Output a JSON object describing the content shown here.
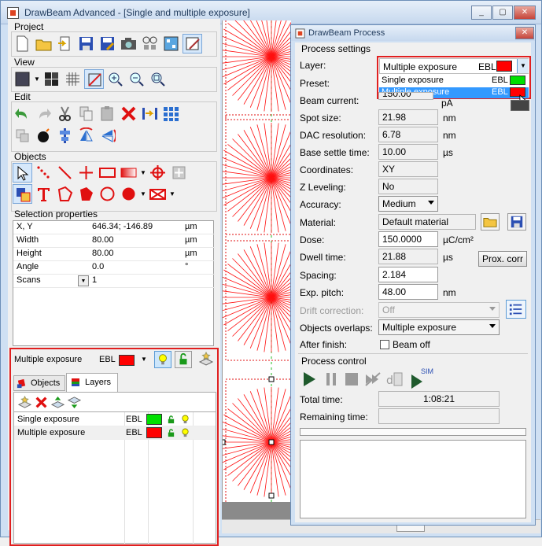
{
  "main_window": {
    "title": "DrawBeam Advanced - [Single and multiple exposure]",
    "controls": {
      "minimize": "_",
      "maximize": "▢",
      "close": "✕"
    }
  },
  "toolbar_groups": {
    "project": "Project",
    "view": "View",
    "edit": "Edit",
    "objects": "Objects"
  },
  "selection_properties": {
    "title": "Selection properties",
    "rows": [
      {
        "key": "X, Y",
        "value": "646.34; -146.89",
        "unit": "µm"
      },
      {
        "key": "Width",
        "value": "80.00",
        "unit": "µm"
      },
      {
        "key": "Height",
        "value": "80.00",
        "unit": "µm"
      },
      {
        "key": "Angle",
        "value": "0.0",
        "unit": "°"
      },
      {
        "key": "Scans",
        "value": "1",
        "unit": ""
      }
    ]
  },
  "layer_panel": {
    "current_layer": "Multiple exposure",
    "current_type": "EBL",
    "tabs": {
      "objects": "Objects",
      "layers": "Layers"
    },
    "layers": [
      {
        "name": "Single exposure",
        "type": "EBL",
        "color": "#00e000"
      },
      {
        "name": "Multiple exposure",
        "type": "EBL",
        "color": "#ff0000"
      }
    ]
  },
  "process_window": {
    "title": "DrawBeam Process",
    "close": "✕",
    "settings_title": "Process settings",
    "layer": {
      "label": "Layer:",
      "value": "Multiple exposure",
      "type": "EBL",
      "dropdown": [
        {
          "name": "Single exposure",
          "type": "EBL",
          "color": "#00e000"
        },
        {
          "name": "Multiple exposure",
          "type": "EBL",
          "color": "#ff0000"
        }
      ]
    },
    "preset": {
      "label": "Preset:"
    },
    "beam_current": {
      "label": "Beam current:",
      "value": "150.00",
      "unit": "pA"
    },
    "spot_size": {
      "label": "Spot size:",
      "value": "21.98",
      "unit": "nm"
    },
    "dac_resolution": {
      "label": "DAC resolution:",
      "value": "6.78",
      "unit": "nm"
    },
    "base_settle": {
      "label": "Base settle time:",
      "value": "10.00",
      "unit": "µs"
    },
    "coordinates": {
      "label": "Coordinates:",
      "value": "XY"
    },
    "z_leveling": {
      "label": "Z Leveling:",
      "value": "No"
    },
    "accuracy": {
      "label": "Accuracy:",
      "value": "Medium"
    },
    "material": {
      "label": "Material:",
      "value": "Default material"
    },
    "dose": {
      "label": "Dose:",
      "value": "150.0000",
      "unit": "µC/cm²"
    },
    "dwell_time": {
      "label": "Dwell time:",
      "value": "21.88",
      "unit": "µs"
    },
    "prox_corr": "Prox. corr",
    "spacing": {
      "label": "Spacing:",
      "value": "2.184"
    },
    "exp_pitch": {
      "label": "Exp. pitch:",
      "value": "48.00",
      "unit": "nm"
    },
    "drift_correction": {
      "label": "Drift correction:",
      "value": "Off"
    },
    "objects_overlaps": {
      "label": "Objects overlaps:",
      "value": "Multiple exposure"
    },
    "after_finish": {
      "label": "After finish:",
      "checkbox_label": "Beam off"
    },
    "control_title": "Process control",
    "sim_label": "SIM",
    "total_time": {
      "label": "Total time:",
      "value": "1:08:21"
    },
    "remaining_time": {
      "label": "Remaining time:",
      "value": ""
    }
  }
}
